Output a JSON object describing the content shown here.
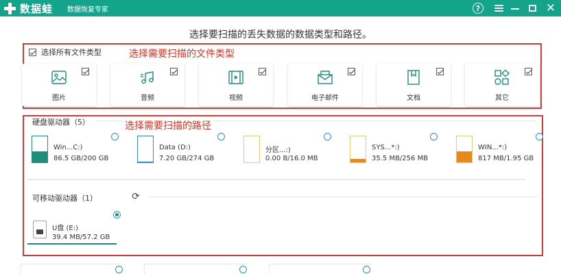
{
  "app": {
    "logo_text": "数据蛙",
    "subtitle": "数据恢复专家",
    "help_symbol": "?",
    "close_symbol": "✕"
  },
  "heading": "选择要扫描的丢失数据的数据类型和路径。",
  "annotations": {
    "file_types": "选择需要扫描的文件类型",
    "paths": "选择需要扫描的路径"
  },
  "select_all_label": "选择所有文件类型",
  "file_types": [
    {
      "label": "图片",
      "icon": "image-icon",
      "checked": true
    },
    {
      "label": "音频",
      "icon": "music-icon",
      "checked": true
    },
    {
      "label": "视频",
      "icon": "video-icon",
      "checked": true
    },
    {
      "label": "电子邮件",
      "icon": "email-icon",
      "checked": true
    },
    {
      "label": "文档",
      "icon": "document-icon",
      "checked": true
    },
    {
      "label": "其它",
      "icon": "other-icon",
      "checked": true
    }
  ],
  "hard_drives": {
    "label": "硬盘驱动器（5）",
    "items": [
      {
        "name": "Win...C:)",
        "size": "86.5 GB/200 GB",
        "used_fraction": 0.43,
        "color": "#1a8f7a",
        "border": "#1a8f7a"
      },
      {
        "name": "Data (D:)",
        "size": "7.20 GB/274 GB",
        "used_fraction": 0.03,
        "color": "#2a8ad0",
        "border": "#2a8ad0"
      },
      {
        "name": "分区...:)",
        "size": "0.00  B/16.0 MB",
        "used_fraction": 0.0,
        "color": "#e6a23c",
        "border": "#e6c87a"
      },
      {
        "name": "SYS...*:)",
        "size": "35.5 MB/256 MB",
        "used_fraction": 0.14,
        "color": "#e8891d",
        "border": "#e6c87a"
      },
      {
        "name": "WIN...*:)",
        "size": "817 MB/1.95 GB",
        "used_fraction": 0.41,
        "color": "#e8891d",
        "border": "#e6c87a"
      }
    ]
  },
  "removable_drives": {
    "label": "可移动驱动器（1）",
    "refresh_symbol": "⟳",
    "items": [
      {
        "name": "U盘 (E:)",
        "size": "39.4 MB/57.2 GB",
        "selected": true
      }
    ]
  }
}
